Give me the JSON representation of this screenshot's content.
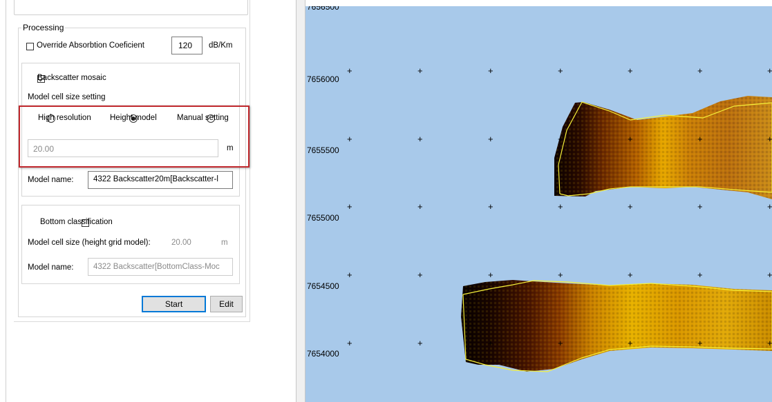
{
  "processing": {
    "group_title": "Processing",
    "override_label": "Override Absorbtion Coeficient",
    "override_checked": false,
    "absorption_value": "120",
    "absorption_unit": "dB/Km"
  },
  "backscatter": {
    "checkbox_label": "Backscatter mosaic",
    "checked": true,
    "cell_size_heading": "Model cell size setting",
    "radio_options": [
      "High resolution",
      "Height model",
      "Manual setting"
    ],
    "selected_option": "Height model",
    "cell_size_value": "20.00",
    "cell_size_unit": "m",
    "model_name_label": "Model name:",
    "model_name_value": "4322 Backscatter20m[Backscatter-l"
  },
  "bottom": {
    "checkbox_label": "Bottom classification",
    "checked": false,
    "cell_size_label": "Model cell size (height grid model):",
    "cell_size_value": "20.00",
    "cell_size_unit": "m",
    "model_name_label": "Model name:",
    "model_name_value": "4322 Backscatter[BottomClass-Moc"
  },
  "buttons": {
    "start": "Start",
    "edit": "Edit"
  },
  "map": {
    "y_labels": [
      "7656500",
      "7656000",
      "7655500",
      "7655000",
      "7654500",
      "7654000"
    ],
    "background": "#a8c9ea",
    "outline_color": "#f5f03a"
  }
}
